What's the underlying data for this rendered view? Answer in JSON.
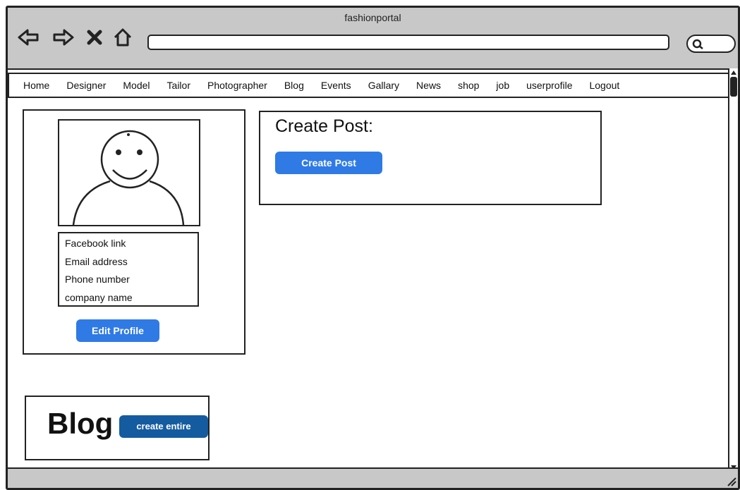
{
  "window": {
    "title": "fashionportal"
  },
  "nav": {
    "icons": [
      "back-arrow-icon",
      "forward-arrow-icon",
      "stop-icon",
      "home-icon"
    ]
  },
  "address_bar": {
    "value": ""
  },
  "search": {
    "icon": "search-icon"
  },
  "menu": {
    "items": [
      {
        "label": "Home"
      },
      {
        "label": "Designer"
      },
      {
        "label": "Model"
      },
      {
        "label": "Tailor"
      },
      {
        "label": "Photographer"
      },
      {
        "label": "Blog"
      },
      {
        "label": "Events"
      },
      {
        "label": "Gallary"
      },
      {
        "label": "News"
      },
      {
        "label": "shop"
      },
      {
        "label": "job"
      },
      {
        "label": "userprofile"
      },
      {
        "label": "Logout"
      }
    ]
  },
  "profile": {
    "avatar_icon": "user-avatar-icon",
    "contacts": [
      {
        "label": "Facebook link"
      },
      {
        "label": "Email address"
      },
      {
        "label": "Phone number"
      },
      {
        "label": "company name"
      }
    ],
    "edit_button": "Edit Profile"
  },
  "post": {
    "heading": "Create Post:",
    "button": "Create Post"
  },
  "blog": {
    "heading": "Blog",
    "button": "create entire"
  },
  "colors": {
    "primary_button": "#2f7ae5",
    "dark_button": "#155b9f",
    "chrome": "#c8c8c8"
  }
}
